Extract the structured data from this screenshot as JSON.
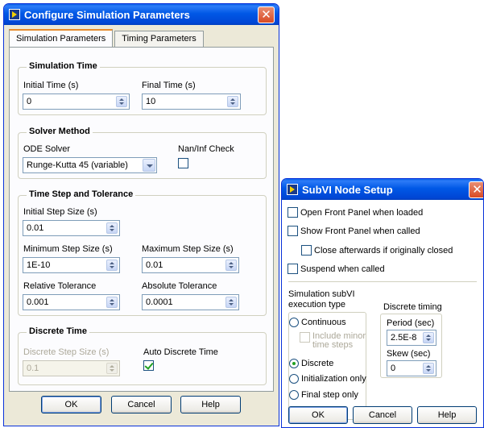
{
  "config_dialog": {
    "title": "Configure Simulation Parameters",
    "close_glyph": "✕",
    "tabs": [
      {
        "label": "Simulation Parameters",
        "active": true
      },
      {
        "label": "Timing Parameters",
        "active": false
      }
    ],
    "simulation_time": {
      "label": "Simulation Time",
      "initial_time_label": "Initial Time (s)",
      "initial_time_value": "0",
      "final_time_label": "Final Time (s)",
      "final_time_value": "10"
    },
    "solver_method": {
      "label": "Solver Method",
      "ode_solver_label": "ODE Solver",
      "ode_solver_value": "Runge-Kutta 45 (variable)",
      "naninf_label": "Nan/Inf Check",
      "naninf_checked": false
    },
    "step_tolerance": {
      "label": "Time Step and Tolerance",
      "initial_step_label": "Initial Step Size (s)",
      "initial_step_value": "0.01",
      "min_step_label": "Minimum Step Size (s)",
      "min_step_value": "1E-10",
      "max_step_label": "Maximum Step Size (s)",
      "max_step_value": "0.01",
      "rel_tol_label": "Relative Tolerance",
      "rel_tol_value": "0.001",
      "abs_tol_label": "Absolute Tolerance",
      "abs_tol_value": "0.0001"
    },
    "discrete_time": {
      "label": "Discrete Time",
      "step_label": "Discrete Step Size (s)",
      "step_value": "0.1",
      "auto_label": "Auto Discrete Time",
      "auto_checked": true
    },
    "buttons": {
      "ok": "OK",
      "cancel": "Cancel",
      "help": "Help"
    }
  },
  "subvi_dialog": {
    "title": "SubVI Node Setup",
    "close_glyph": "✕",
    "options": {
      "open_front_panel": "Open Front Panel when loaded",
      "show_front_panel": "Show Front Panel when called",
      "close_afterwards": "Close afterwards if originally closed",
      "suspend": "Suspend when called"
    },
    "execution_type_label_1": "Simulation subVI",
    "execution_type_label_2": "execution type",
    "radios": {
      "continuous": "Continuous",
      "include_minor_1": "Include minor",
      "include_minor_2": "time steps",
      "discrete": "Discrete",
      "init_only": "Initialization only",
      "final_only": "Final step only"
    },
    "selected_type": "Discrete",
    "discrete_timing_label": "Discrete timing",
    "period_label": "Period (sec)",
    "period_value": "2.5E-8",
    "skew_label": "Skew (sec)",
    "skew_value": "0",
    "buttons": {
      "ok": "OK",
      "cancel": "Cancel",
      "help": "Help"
    }
  }
}
